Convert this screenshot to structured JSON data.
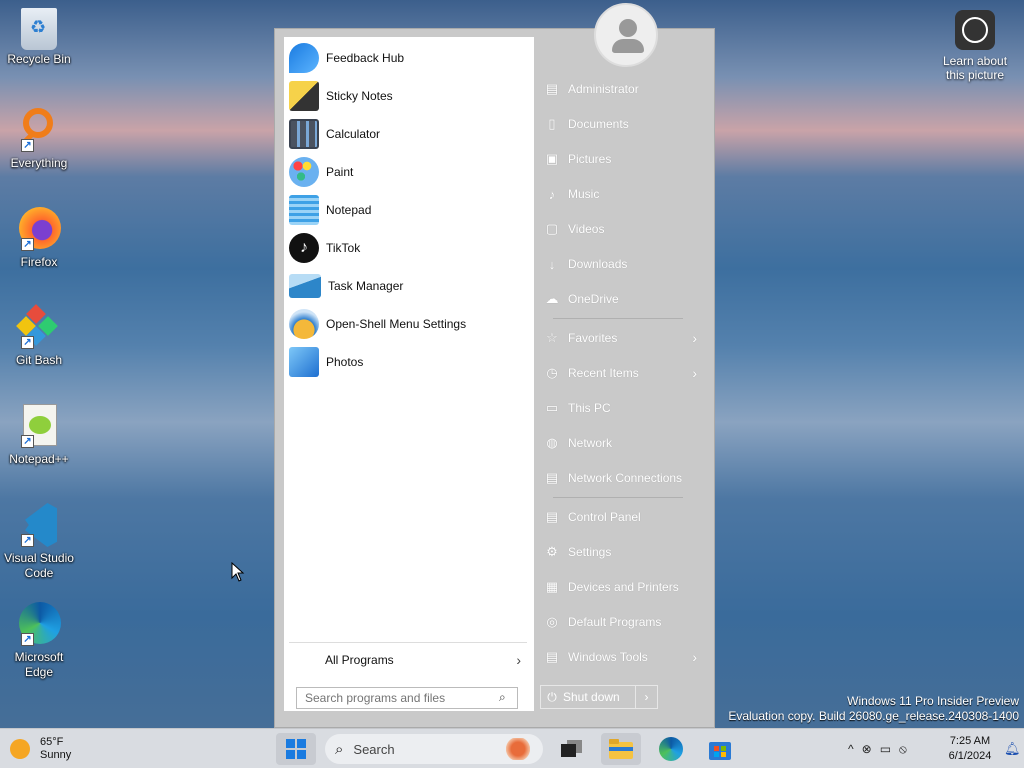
{
  "desktop": {
    "icons": [
      {
        "label": "Recycle Bin",
        "icon": "recycle-bin-icon"
      },
      {
        "label": "Everything",
        "icon": "everything-search-icon"
      },
      {
        "label": "Firefox",
        "icon": "firefox-icon"
      },
      {
        "label": "Git Bash",
        "icon": "git-bash-icon"
      },
      {
        "label": "Notepad++",
        "icon": "notepad-plus-plus-icon"
      },
      {
        "label": "Visual Studio Code",
        "icon": "vscode-icon"
      },
      {
        "label": "Microsoft Edge",
        "icon": "edge-icon"
      }
    ],
    "learn_about": "Learn about this picture",
    "watermark_line1": "Windows 11 Pro Insider Preview",
    "watermark_line2": "Evaluation copy. Build 26080.ge_release.240308-1400"
  },
  "start_menu": {
    "programs": [
      {
        "label": "Feedback Hub",
        "icon": "feedback-hub-icon"
      },
      {
        "label": "Sticky Notes",
        "icon": "sticky-notes-icon"
      },
      {
        "label": "Calculator",
        "icon": "calculator-icon"
      },
      {
        "label": "Paint",
        "icon": "paint-icon"
      },
      {
        "label": "Notepad",
        "icon": "notepad-icon"
      },
      {
        "label": "TikTok",
        "icon": "tiktok-icon"
      },
      {
        "label": "Task Manager",
        "icon": "task-manager-icon"
      },
      {
        "label": "Open-Shell Menu Settings",
        "icon": "open-shell-icon"
      },
      {
        "label": "Photos",
        "icon": "photos-icon"
      }
    ],
    "all_programs": "All Programs",
    "search_placeholder": "Search programs and files",
    "right_items": [
      {
        "label": "Administrator",
        "icon": "user-folder-icon"
      },
      {
        "label": "Documents",
        "icon": "documents-icon"
      },
      {
        "label": "Pictures",
        "icon": "pictures-icon"
      },
      {
        "label": "Music",
        "icon": "music-icon"
      },
      {
        "label": "Videos",
        "icon": "videos-icon"
      },
      {
        "label": "Downloads",
        "icon": "downloads-icon"
      },
      {
        "label": "OneDrive",
        "icon": "onedrive-icon"
      },
      {
        "label": "Favorites",
        "icon": "star-icon"
      },
      {
        "label": "Recent Items",
        "icon": "clock-icon"
      },
      {
        "label": "This PC",
        "icon": "computer-icon"
      },
      {
        "label": "Network",
        "icon": "network-icon"
      },
      {
        "label": "Network Connections",
        "icon": "network-connections-icon"
      },
      {
        "label": "Control Panel",
        "icon": "control-panel-icon"
      },
      {
        "label": "Settings",
        "icon": "gear-icon"
      },
      {
        "label": "Devices and Printers",
        "icon": "printer-icon"
      },
      {
        "label": "Default Programs",
        "icon": "default-programs-icon"
      },
      {
        "label": "Windows Tools",
        "icon": "windows-tools-icon"
      }
    ],
    "shutdown_label": "Shut down"
  },
  "taskbar": {
    "weather_temp": "65°F",
    "weather_desc": "Sunny",
    "search_label": "Search",
    "time": "7:25 AM",
    "date": "6/1/2024"
  }
}
